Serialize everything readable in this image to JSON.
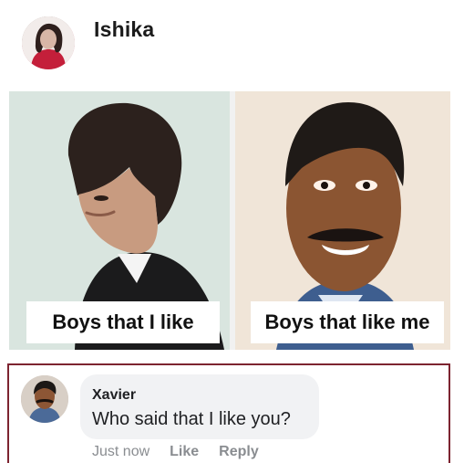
{
  "post": {
    "author": "Ishika"
  },
  "meme": {
    "left_caption": "Boys that I like",
    "right_caption": "Boys that like me"
  },
  "comment": {
    "author": "Xavier",
    "text": "Who said that I like you?",
    "timestamp": "Just now",
    "like_label": "Like",
    "reply_label": "Reply"
  },
  "colors": {
    "highlight_border": "#7d2430",
    "bubble_bg": "#f1f2f4",
    "meta_text": "#8a8d91"
  }
}
